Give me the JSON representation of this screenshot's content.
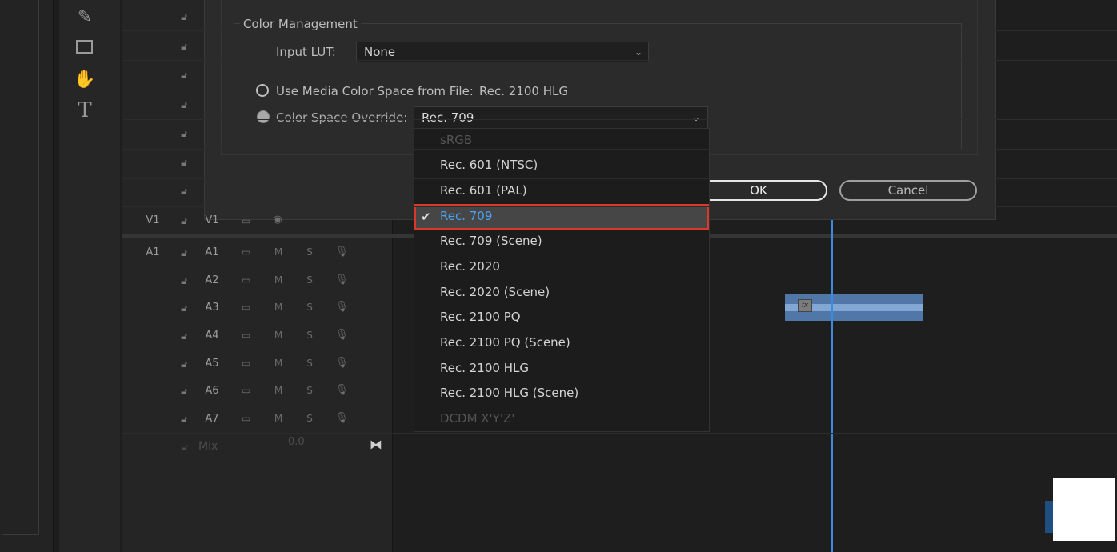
{
  "dialog": {
    "group_title": "Color Management",
    "input_lut_label": "Input LUT:",
    "input_lut_value": "None",
    "media_color_space_label": "Use Media Color Space from File:",
    "media_color_space_value": "Rec. 2100 HLG",
    "override_label": "Color Space Override:",
    "override_value": "Rec. 709",
    "ok_label": "OK",
    "cancel_label": "Cancel"
  },
  "dropdown": {
    "options": [
      {
        "label": "sRGB",
        "enabled": false
      },
      {
        "label": "Rec. 601 (NTSC)",
        "enabled": true
      },
      {
        "label": "Rec. 601 (PAL)",
        "enabled": true
      },
      {
        "label": "Rec. 709",
        "enabled": true,
        "selected": true
      },
      {
        "label": "Rec. 709 (Scene)",
        "enabled": true
      },
      {
        "label": "Rec. 2020",
        "enabled": true
      },
      {
        "label": "Rec. 2020 (Scene)",
        "enabled": true
      },
      {
        "label": "Rec. 2100 PQ",
        "enabled": true
      },
      {
        "label": "Rec. 2100 PQ (Scene)",
        "enabled": true
      },
      {
        "label": "Rec. 2100 HLG",
        "enabled": true
      },
      {
        "label": "Rec. 2100 HLG (Scene)",
        "enabled": true
      },
      {
        "label": "DCDM X'Y'Z'",
        "enabled": false
      }
    ]
  },
  "timeline": {
    "video_track": {
      "source": "V1",
      "target": "V1"
    },
    "audio_tracks": [
      {
        "source": "A1",
        "target": "A1",
        "mute": "M",
        "solo": "S"
      },
      {
        "source": "",
        "target": "A2",
        "mute": "M",
        "solo": "S"
      },
      {
        "source": "",
        "target": "A3",
        "mute": "M",
        "solo": "S"
      },
      {
        "source": "",
        "target": "A4",
        "mute": "M",
        "solo": "S"
      },
      {
        "source": "",
        "target": "A5",
        "mute": "M",
        "solo": "S"
      },
      {
        "source": "",
        "target": "A6",
        "mute": "M",
        "solo": "S"
      },
      {
        "source": "",
        "target": "A7",
        "mute": "M",
        "solo": "S"
      }
    ],
    "mix_label": "Mix",
    "mix_value": "0.0",
    "clip_fx": "fx"
  },
  "tools": [
    "pen-tool-icon",
    "rectangle-tool-icon",
    "hand-tool-icon",
    "type-tool-icon"
  ],
  "colors": {
    "playhead": "#3b8ce0",
    "highlight_border": "#d9382a",
    "selected_text": "#4aa2f0"
  }
}
